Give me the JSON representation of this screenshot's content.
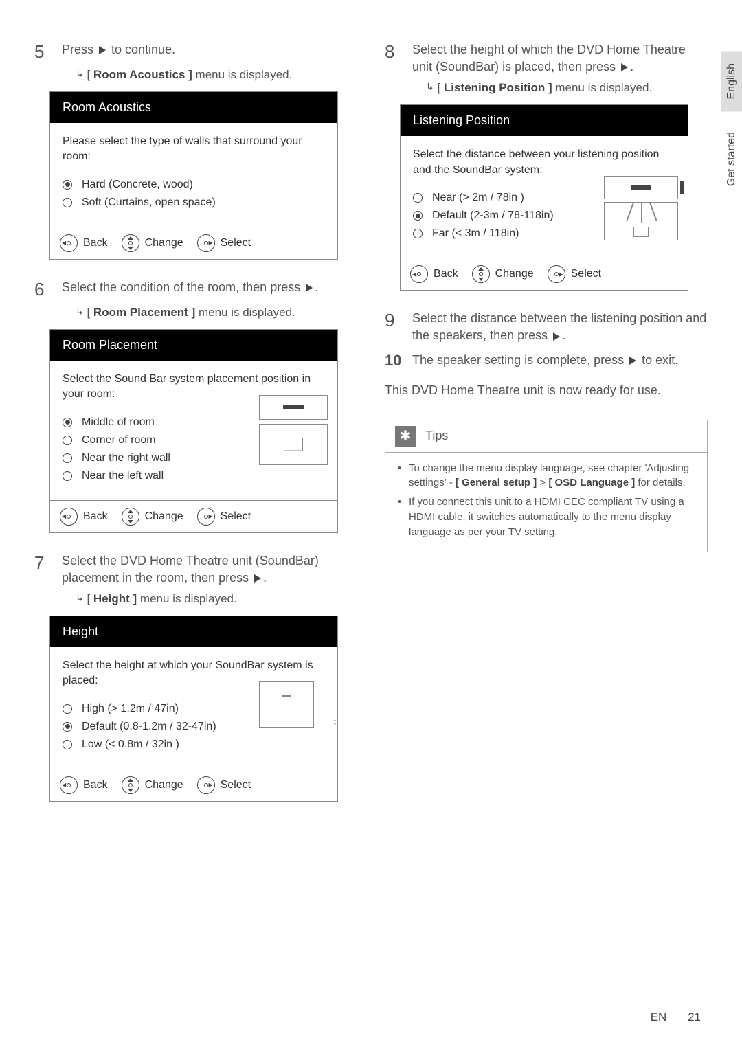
{
  "sidebar": {
    "lang": "English",
    "section": "Get started"
  },
  "steps": {
    "s5": {
      "num": "5",
      "text_a": "Press ",
      "text_b": " to continue.",
      "sub_prefix": "[ ",
      "sub_strong": "Room Acoustics ]",
      "sub_suffix": " menu is displayed."
    },
    "box1": {
      "title": "Room Acoustics",
      "prompt": "Please select the type of walls that surround your room:",
      "opts": [
        "Hard (Concrete, wood)",
        "Soft (Curtains, open space)"
      ],
      "selected": 0
    },
    "s6": {
      "num": "6",
      "text": "Select the condition of the room, then press ",
      "sub_strong": "Room Placement ]",
      "sub_suffix": " menu is displayed."
    },
    "box2": {
      "title": "Room Placement",
      "prompt": "Select the Sound Bar system placement position in your room:",
      "opts": [
        "Middle of room",
        "Corner of room",
        "Near the right wall",
        "Near the left wall"
      ],
      "selected": 0
    },
    "s7": {
      "num": "7",
      "text": "Select the DVD Home Theatre unit (SoundBar) placement in the room, then press ",
      "sub_strong": "Height ]",
      "sub_suffix": " menu is displayed."
    },
    "box3": {
      "title": "Height",
      "prompt": "Select the height at which your SoundBar system is placed:",
      "opts": [
        "High (> 1.2m / 47in)",
        "Default (0.8-1.2m / 32-47in)",
        "Low (< 0.8m / 32in )"
      ],
      "selected": 1
    },
    "s8": {
      "num": "8",
      "text": "Select the height of which the DVD Home Theatre unit (SoundBar) is placed, then press ",
      "sub_strong": "Listening Position ]",
      "sub_suffix": " menu is displayed."
    },
    "box4": {
      "title": "Listening Position",
      "prompt": "Select the distance between your listening position and the SoundBar system:",
      "opts": [
        "Near (> 2m / 78in )",
        "Default (2-3m / 78-118in)",
        "Far (< 3m / 118in)"
      ],
      "selected": 1
    },
    "s9": {
      "num": "9",
      "text": "Select the distance between the listening position and the speakers, then press "
    },
    "s10": {
      "num": "10",
      "text_a": "The speaker setting is complete, press ",
      "text_b": " to exit."
    }
  },
  "footer_labels": {
    "back": "Back",
    "change": "Change",
    "select": "Select"
  },
  "closing": "This DVD Home Theatre unit is now ready for use.",
  "tips": {
    "title": "Tips",
    "items": [
      {
        "a": "To change the menu display language, see chapter 'Adjusting settings' - ",
        "b": "[ General setup ]",
        "c": " > ",
        "d": "[ OSD Language ]",
        "e": " for details."
      },
      {
        "a": "If you connect this unit to a HDMI CEC compliant TV using a HDMI cable, it switches automatically to the menu display language as per your TV setting."
      }
    ]
  },
  "page": {
    "lang_code": "EN",
    "num": "21"
  },
  "sub_prefix": "[ ",
  "map_arrow": "↳"
}
